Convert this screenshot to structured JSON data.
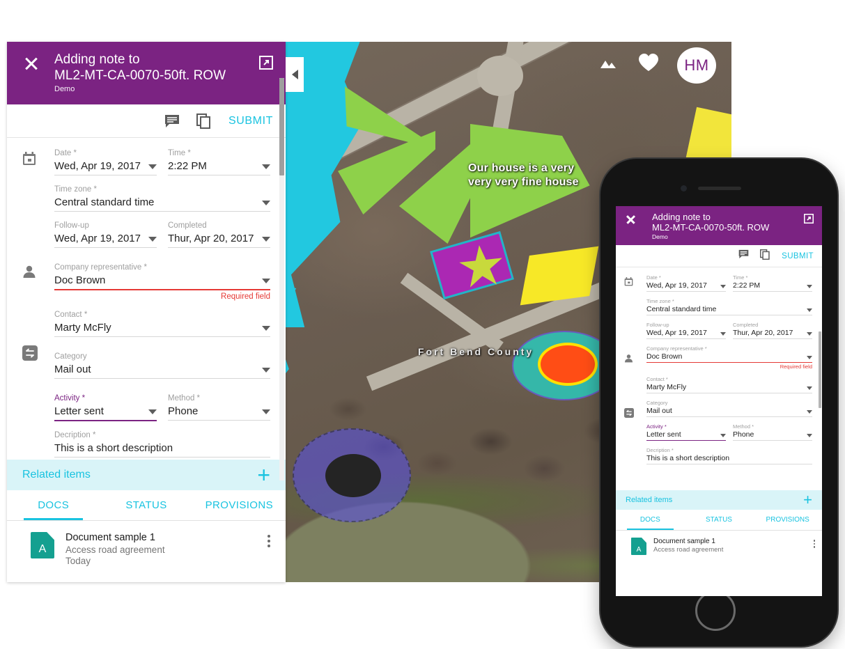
{
  "colors": {
    "brand_purple": "#7b2382",
    "accent_cyan": "#19c3e0",
    "error_red": "#e53935",
    "related_bg": "#d9f4f8",
    "doc_teal": "#14a090"
  },
  "header": {
    "title_line1": "Adding note to",
    "title_line2": "ML2-MT-CA-0070-50ft. ROW",
    "subtitle": "Demo",
    "close_icon": "close-icon",
    "expand_icon": "open-in-new-icon"
  },
  "actions": {
    "comment_icon": "comment-icon",
    "copy_icon": "copy-icon",
    "submit_label": "SUBMIT"
  },
  "form": {
    "gutter_icons": [
      "calendar-icon",
      "person-icon",
      "compare-arrows-icon"
    ],
    "fields": {
      "date": {
        "label": "Date *",
        "value": "Wed, Apr 19, 2017"
      },
      "time": {
        "label": "Time *",
        "value": "2:22 PM"
      },
      "timezone": {
        "label": "Time zone *",
        "value": "Central standard time"
      },
      "followup": {
        "label": "Follow-up",
        "value": "Wed, Apr 19, 2017"
      },
      "completed": {
        "label": "Completed",
        "value": "Thur, Apr 20, 2017"
      },
      "company_rep": {
        "label": "Company representative *",
        "value": "Doc Brown",
        "error": "Required field"
      },
      "contact": {
        "label": "Contact *",
        "value": "Marty McFly"
      },
      "category": {
        "label": "Category",
        "value": "Mail out"
      },
      "activity": {
        "label": "Activity *",
        "value": "Letter sent"
      },
      "method": {
        "label": "Method *",
        "value": "Phone"
      },
      "description": {
        "label": "Decription *",
        "value": "This is a short description"
      }
    }
  },
  "related": {
    "title": "Related items",
    "add_label": "+",
    "tabs": [
      {
        "label": "DOCS",
        "active": true
      },
      {
        "label": "STATUS",
        "active": false
      },
      {
        "label": "PROVISIONS",
        "active": false
      }
    ],
    "documents": [
      {
        "icon_letter": "A",
        "title": "Document sample 1",
        "subtitle": "Access road agreement",
        "date": "Today"
      }
    ]
  },
  "map": {
    "labels": [
      {
        "name": "house-annotation",
        "text": "Our house is a very\nvery very fine house"
      },
      {
        "name": "county-label",
        "text": "Fort Bend County"
      }
    ],
    "controls": {
      "layers_icon": "layers-icon",
      "favorite_icon": "heart-icon",
      "avatar_initials": "HM"
    },
    "collapse_icon": "chevron-left-icon"
  }
}
